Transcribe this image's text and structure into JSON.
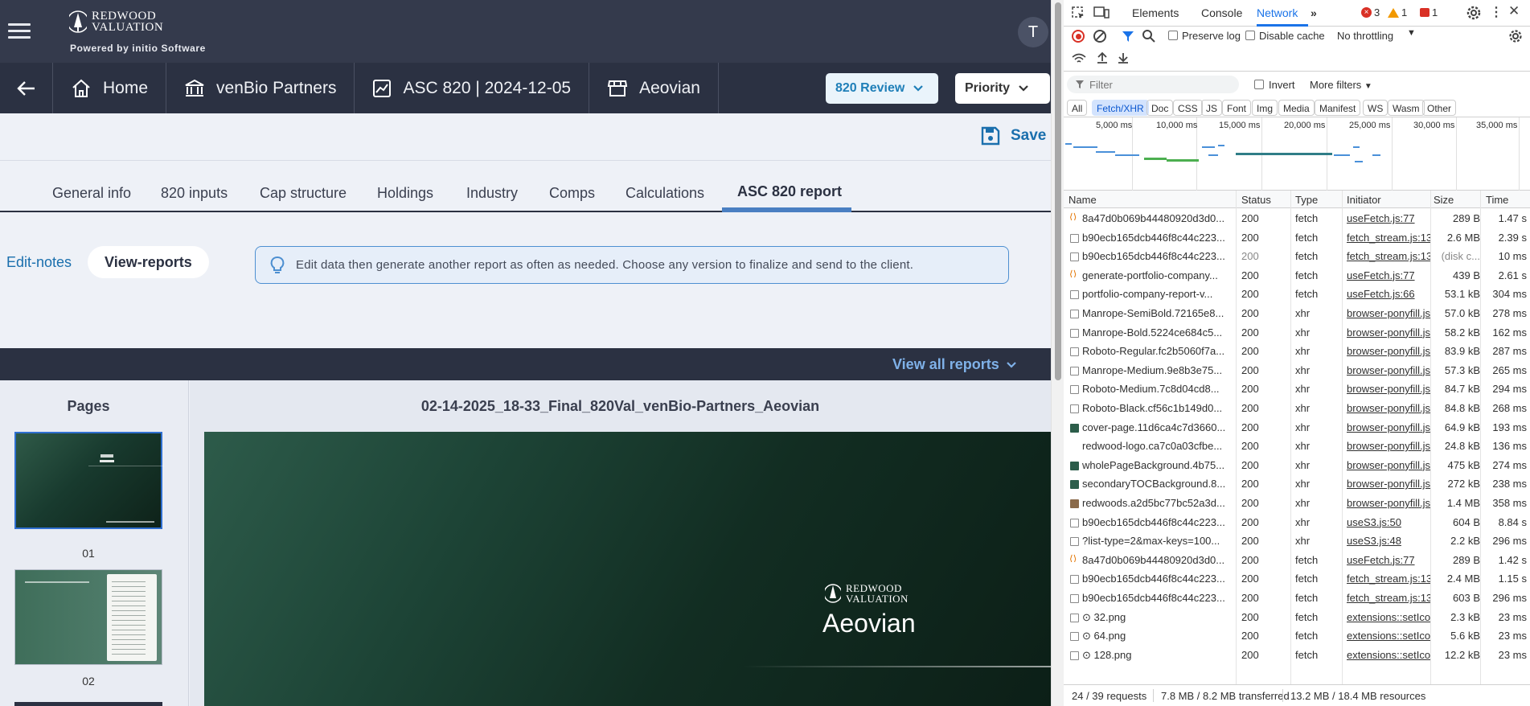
{
  "app": {
    "logo_line1": "REDWOOD",
    "logo_line2": "VALUATION",
    "powered_by": "Powered by initio Software",
    "avatar_initial": "T",
    "breadcrumbs": [
      {
        "label": "Home",
        "icon": "home-icon"
      },
      {
        "label": "venBio Partners",
        "icon": "bank-icon"
      },
      {
        "label": "ASC 820 | 2024-12-05",
        "icon": "chart-icon"
      },
      {
        "label": "Aeovian",
        "icon": "store-icon"
      }
    ],
    "review_button": "820 Review",
    "priority_button": "Priority",
    "save_label": "Save",
    "tabs": [
      "General info",
      "820 inputs",
      "Cap structure",
      "Holdings",
      "Industry",
      "Comps",
      "Calculations",
      "ASC 820 report"
    ],
    "active_tab": "ASC 820 report",
    "segment": {
      "edit_notes": "Edit-notes",
      "view_reports": "View-reports"
    },
    "info_message": "Edit data then generate another report as often as needed. Choose any version to finalize and send to the client.",
    "view_all_reports": "View all reports",
    "pages_title": "Pages",
    "page_numbers": [
      "01",
      "02"
    ],
    "report_filename": "02-14-2025_18-33_Final_820Val_venBio-Partners_Aeovian",
    "cover_company": "Aeovian",
    "accent_color": "#1a6fad"
  },
  "devtools": {
    "tabs": [
      "Elements",
      "Console",
      "Network"
    ],
    "active_tab": "Network",
    "error_count": "3",
    "warning_count": "1",
    "issue_count": "1",
    "preserve_log": "Preserve log",
    "disable_cache": "Disable cache",
    "throttling": "No throttling",
    "filter_placeholder": "Filter",
    "invert": "Invert",
    "more_filters": "More filters",
    "type_filters": [
      "All",
      "Fetch/XHR",
      "Doc",
      "CSS",
      "JS",
      "Font",
      "Img",
      "Media",
      "Manifest",
      "WS",
      "Wasm",
      "Other"
    ],
    "active_type": "Fetch/XHR",
    "timeline_labels": [
      "5,000 ms",
      "10,000 ms",
      "15,000 ms",
      "20,000 ms",
      "25,000 ms",
      "30,000 ms",
      "35,000 ms"
    ],
    "columns": [
      "Name",
      "Status",
      "Type",
      "Initiator",
      "Size",
      "Time"
    ],
    "requests": [
      {
        "name": "8a47d0b069b44480920d3d0...",
        "status": "200",
        "type": "fetch",
        "initiator": "useFetch.js:77",
        "size": "289 B",
        "time": "1.47 s",
        "icon": "fetch"
      },
      {
        "name": "b90ecb165dcb446f8c44c223...",
        "status": "200",
        "type": "fetch",
        "initiator": "fetch_stream.js:13",
        "size": "2.6 MB",
        "time": "2.39 s",
        "icon": "doc"
      },
      {
        "name": "b90ecb165dcb446f8c44c223...",
        "status": "200",
        "type": "fetch",
        "initiator": "fetch_stream.js:13",
        "size": "(disk c...",
        "time": "10 ms",
        "icon": "doc"
      },
      {
        "name": "generate-portfolio-company...",
        "status": "200",
        "type": "fetch",
        "initiator": "useFetch.js:77",
        "size": "439 B",
        "time": "2.61 s",
        "icon": "fetch"
      },
      {
        "name": "portfolio-company-report-v...",
        "status": "200",
        "type": "fetch",
        "initiator": "useFetch.js:66",
        "size": "53.1 kB",
        "time": "304 ms",
        "icon": "doc"
      },
      {
        "name": "Manrope-SemiBold.72165e8...",
        "status": "200",
        "type": "xhr",
        "initiator": "browser-ponyfill.js",
        "size": "57.0 kB",
        "time": "278 ms",
        "icon": "doc"
      },
      {
        "name": "Manrope-Bold.5224ce684c5...",
        "status": "200",
        "type": "xhr",
        "initiator": "browser-ponyfill.js",
        "size": "58.2 kB",
        "time": "162 ms",
        "icon": "doc"
      },
      {
        "name": "Roboto-Regular.fc2b5060f7a...",
        "status": "200",
        "type": "xhr",
        "initiator": "browser-ponyfill.js",
        "size": "83.9 kB",
        "time": "287 ms",
        "icon": "doc"
      },
      {
        "name": "Manrope-Medium.9e8b3e75...",
        "status": "200",
        "type": "xhr",
        "initiator": "browser-ponyfill.js",
        "size": "57.3 kB",
        "time": "265 ms",
        "icon": "doc"
      },
      {
        "name": "Roboto-Medium.7c8d04cd8...",
        "status": "200",
        "type": "xhr",
        "initiator": "browser-ponyfill.js",
        "size": "84.7 kB",
        "time": "294 ms",
        "icon": "doc"
      },
      {
        "name": "Roboto-Black.cf56c1b149d0...",
        "status": "200",
        "type": "xhr",
        "initiator": "browser-ponyfill.js",
        "size": "84.8 kB",
        "time": "268 ms",
        "icon": "doc"
      },
      {
        "name": "cover-page.11d6ca4c7d3660...",
        "status": "200",
        "type": "xhr",
        "initiator": "browser-ponyfill.js",
        "size": "64.9 kB",
        "time": "193 ms",
        "icon": "img"
      },
      {
        "name": "redwood-logo.ca7c0a03cfbe...",
        "status": "200",
        "type": "xhr",
        "initiator": "browser-ponyfill.js",
        "size": "24.8 kB",
        "time": "136 ms",
        "icon": "none"
      },
      {
        "name": "wholePageBackground.4b75...",
        "status": "200",
        "type": "xhr",
        "initiator": "browser-ponyfill.js",
        "size": "475 kB",
        "time": "274 ms",
        "icon": "img"
      },
      {
        "name": "secondaryTOCBackground.8...",
        "status": "200",
        "type": "xhr",
        "initiator": "browser-ponyfill.js",
        "size": "272 kB",
        "time": "238 ms",
        "icon": "img"
      },
      {
        "name": "redwoods.a2d5bc77bc52a3d...",
        "status": "200",
        "type": "xhr",
        "initiator": "browser-ponyfill.js",
        "size": "1.4 MB",
        "time": "358 ms",
        "icon": "img2"
      },
      {
        "name": "b90ecb165dcb446f8c44c223...",
        "status": "200",
        "type": "xhr",
        "initiator": "useS3.js:50",
        "size": "604 B",
        "time": "8.84 s",
        "icon": "doc"
      },
      {
        "name": "?list-type=2&max-keys=100...",
        "status": "200",
        "type": "xhr",
        "initiator": "useS3.js:48",
        "size": "2.2 kB",
        "time": "296 ms",
        "icon": "doc"
      },
      {
        "name": "8a47d0b069b44480920d3d0...",
        "status": "200",
        "type": "fetch",
        "initiator": "useFetch.js:77",
        "size": "289 B",
        "time": "1.42 s",
        "icon": "fetch"
      },
      {
        "name": "b90ecb165dcb446f8c44c223...",
        "status": "200",
        "type": "fetch",
        "initiator": "fetch_stream.js:13",
        "size": "2.4 MB",
        "time": "1.15 s",
        "icon": "doc"
      },
      {
        "name": "b90ecb165dcb446f8c44c223...",
        "status": "200",
        "type": "fetch",
        "initiator": "fetch_stream.js:13",
        "size": "603 B",
        "time": "296 ms",
        "icon": "doc"
      },
      {
        "name": "⊙ 32.png",
        "status": "200",
        "type": "fetch",
        "initiator": "extensions::setIco",
        "size": "2.3 kB",
        "time": "23 ms",
        "icon": "doc"
      },
      {
        "name": "⊙ 64.png",
        "status": "200",
        "type": "fetch",
        "initiator": "extensions::setIco",
        "size": "5.6 kB",
        "time": "23 ms",
        "icon": "doc"
      },
      {
        "name": "⊙ 128.png",
        "status": "200",
        "type": "fetch",
        "initiator": "extensions::setIco",
        "size": "12.2 kB",
        "time": "23 ms",
        "icon": "doc"
      }
    ],
    "status_requests": "24 / 39 requests",
    "status_transferred": "7.8 MB / 8.2 MB transferred",
    "status_resources": "13.2 MB / 18.4 MB resources"
  }
}
